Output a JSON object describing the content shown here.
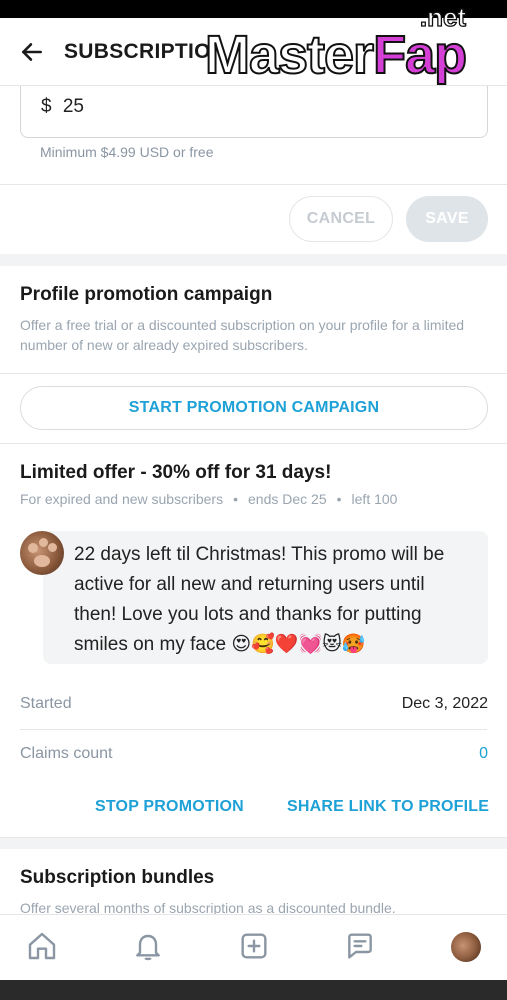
{
  "header": {
    "title": "SUBSCRIPTIO",
    "watermark": {
      "main": "Master",
      "accent": "Fap",
      "tld": ".net"
    }
  },
  "price": {
    "currency_symbol": "$",
    "value": "25",
    "hint": "Minimum $4.99 USD or free"
  },
  "actions": {
    "cancel_label": "CANCEL",
    "save_label": "SAVE"
  },
  "promotion": {
    "title": "Profile promotion campaign",
    "description": "Offer a free trial or a discounted subscription on your profile for a limited number of new or already expired subscribers.",
    "start_button": "START PROMOTION CAMPAIGN"
  },
  "offer": {
    "title": "Limited offer - 30% off for 31 days!",
    "audience": "For expired and new subscribers",
    "ends": "ends Dec 25",
    "left": "left 100",
    "separator": "•",
    "message": "22 days left til Christmas! This promo will be active for all new and returning users until then! Love you lots and thanks for putting smiles on my face 😍🥰❤️💓😻🥵",
    "started_label": "Started",
    "started_value": "Dec 3, 2022",
    "claims_label": "Claims count",
    "claims_value": "0",
    "stop_label": "STOP PROMOTION",
    "share_label": "SHARE LINK TO PROFILE"
  },
  "bundles": {
    "title": "Subscription bundles",
    "description": "Offer several months of subscription as a discounted bundle."
  },
  "nav": {
    "items": [
      {
        "name": "home-icon"
      },
      {
        "name": "bell-icon"
      },
      {
        "name": "plus-square-icon"
      },
      {
        "name": "message-icon"
      },
      {
        "name": "profile-avatar"
      }
    ]
  },
  "colors": {
    "accent": "#1ea1d6",
    "muted": "#9aa5b0",
    "save_disabled": "#dfe4e8",
    "bubble_bg": "#f2f4f5"
  }
}
